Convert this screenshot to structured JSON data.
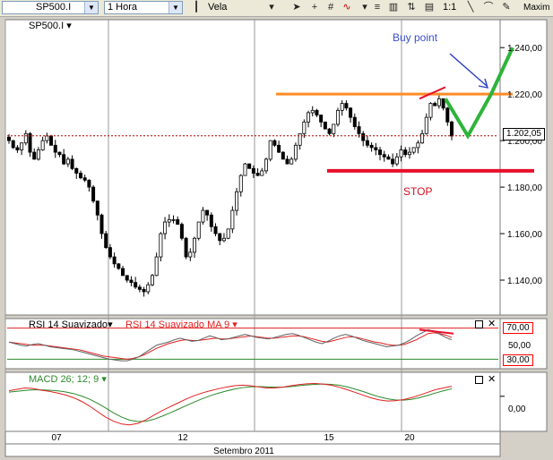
{
  "toolbar": {
    "symbol": "SP500.I",
    "interval": "1 Hora",
    "chart_type": "Vela",
    "ratio": "1:1",
    "maximize_label": "Maxim",
    "icons": [
      "cursor-icon",
      "crosshair-icon",
      "grid-icon",
      "wave-icon",
      "studies-icon",
      "compare-icon",
      "indicator-icon",
      "zoom-icon",
      "magnet-icon",
      "bar-icon",
      "line-tool-icon",
      "arrow-tool-icon",
      "pen-tool-icon"
    ]
  },
  "colors": {
    "background": "#ffffff",
    "frame": "#d4d0c8",
    "up_candle": "#ffffff",
    "down_candle": "#000000",
    "resistance": "#ff8c28",
    "stop": "#e8102a",
    "buy_arrow": "#2a3fbf",
    "projection": "#2db43a",
    "rsi_line": "#606060",
    "rsi_ma": "#e02020",
    "macd_line": "#e02020",
    "macd_signal": "#2a8a2a",
    "dotted_price": "#b00000"
  },
  "chart_data": [
    {
      "type": "candlestick",
      "series_label": "SP500.I",
      "title": "",
      "y_ticks": [
        "1.240,00",
        "1.220,00",
        "1.200,00",
        "1.180,00",
        "1.160,00",
        "1.140,00"
      ],
      "ylim": [
        1125,
        1252
      ],
      "last_price": "1.202,05",
      "x_ticks": [
        "07",
        "12",
        "15",
        "20"
      ],
      "x_axis_label": "Setembro 2011",
      "path_close": [
        1200,
        1197,
        1196,
        1199,
        1203,
        1195,
        1192,
        1196,
        1200,
        1202,
        1198,
        1195,
        1194,
        1190,
        1192,
        1188,
        1186,
        1184,
        1183,
        1180,
        1174,
        1168,
        1160,
        1154,
        1150,
        1147,
        1145,
        1142,
        1140,
        1139,
        1137,
        1136,
        1135,
        1138,
        1142,
        1150,
        1160,
        1165,
        1166,
        1166,
        1164,
        1158,
        1150,
        1152,
        1158,
        1165,
        1170,
        1168,
        1163,
        1160,
        1157,
        1158,
        1162,
        1170,
        1178,
        1185,
        1190,
        1188,
        1186,
        1185,
        1187,
        1192,
        1200,
        1198,
        1195,
        1192,
        1190,
        1192,
        1198,
        1203,
        1208,
        1212,
        1213,
        1211,
        1208,
        1205,
        1203,
        1207,
        1213,
        1216,
        1214,
        1210,
        1206,
        1203,
        1200,
        1198,
        1197,
        1196,
        1194,
        1193,
        1192,
        1190,
        1193,
        1196,
        1194,
        1195,
        1197,
        1199,
        1203,
        1210,
        1216,
        1215,
        1218,
        1214,
        1208,
        1202
      ],
      "annotations": [
        {
          "text": "Buy point",
          "kind": "label"
        },
        {
          "text": "STOP",
          "kind": "label"
        },
        {
          "kind": "hline",
          "name": "resistance",
          "value": 1220
        },
        {
          "kind": "hline",
          "name": "stop",
          "value": 1187
        },
        {
          "kind": "hline",
          "name": "last-price-dotted",
          "value": 1202.05
        }
      ]
    },
    {
      "type": "line",
      "series_label": "RSI 14 Suavizado",
      "ma_label": "RSI 14 Suavizado MA 9",
      "levels": [
        "70,00",
        "50,00",
        "30,00"
      ],
      "ylim": [
        20,
        80
      ],
      "rsi": [
        52,
        50,
        48,
        47,
        49,
        50,
        48,
        46,
        45,
        44,
        43,
        42,
        40,
        38,
        36,
        34,
        32,
        30,
        29,
        28,
        28,
        30,
        33,
        38,
        43,
        48,
        50,
        52,
        55,
        57,
        55,
        53,
        54,
        57,
        60,
        58,
        55,
        56,
        58,
        60,
        62,
        60,
        58,
        57,
        56,
        58,
        60,
        62,
        63,
        61,
        58,
        55,
        52,
        50,
        53,
        57,
        60,
        62,
        60,
        57,
        54,
        52,
        50,
        48,
        46,
        47,
        48,
        51,
        55,
        60,
        64,
        68,
        66,
        62,
        58,
        55
      ],
      "rsi_ma": [
        52,
        51,
        50,
        49,
        48,
        48,
        48,
        47,
        46,
        45,
        44,
        43,
        42,
        40,
        38,
        36,
        34,
        33,
        32,
        31,
        30,
        31,
        33,
        36,
        40,
        44,
        47,
        50,
        52,
        54,
        55,
        54,
        54,
        55,
        56,
        57,
        56,
        56,
        57,
        58,
        59,
        60,
        59,
        58,
        57,
        57,
        58,
        59,
        60,
        60,
        59,
        57,
        55,
        53,
        52,
        54,
        56,
        58,
        59,
        58,
        56,
        54,
        52,
        51,
        49,
        48,
        48,
        49,
        52,
        55,
        59,
        63,
        64,
        63,
        61,
        58
      ]
    },
    {
      "type": "line",
      "series_label": "MACD 26; 12; 9",
      "zero_label": "0,00",
      "ylim": [
        -12,
        8
      ],
      "macd": [
        2,
        2.5,
        3,
        2.8,
        2.2,
        1.8,
        1.2,
        0.5,
        -0.5,
        -1.8,
        -3.5,
        -5.5,
        -7.5,
        -9,
        -10,
        -10.3,
        -9.8,
        -8.5,
        -6.8,
        -5.2,
        -3.8,
        -2.4,
        -1,
        0.2,
        1.2,
        2,
        2.7,
        3.3,
        3.8,
        4,
        3.8,
        3.4,
        3,
        3,
        3.3,
        3.8,
        4.2,
        4.5,
        4.6,
        4.4,
        4,
        3.3,
        2.4,
        1.4,
        0.4,
        -0.6,
        -1.3,
        -1.7,
        -1.6,
        -1.2,
        -0.5,
        0.4,
        1.4,
        2.4,
        3,
        3.6
      ],
      "signal": [
        1.5,
        1.8,
        2.1,
        2.3,
        2.3,
        2.2,
        2,
        1.6,
        1,
        0.1,
        -1,
        -2.5,
        -4.2,
        -6,
        -7.5,
        -8.6,
        -9.1,
        -9,
        -8.3,
        -7.2,
        -6,
        -4.7,
        -3.4,
        -2.1,
        -0.9,
        0.2,
        1.1,
        1.9,
        2.6,
        3.1,
        3.4,
        3.5,
        3.4,
        3.3,
        3.3,
        3.5,
        3.8,
        4.1,
        4.3,
        4.4,
        4.3,
        4,
        3.4,
        2.6,
        1.7,
        0.7,
        -0.2,
        -0.9,
        -1.3,
        -1.4,
        -1.1,
        -0.5,
        0.3,
        1.2,
        2,
        2.7
      ]
    }
  ]
}
